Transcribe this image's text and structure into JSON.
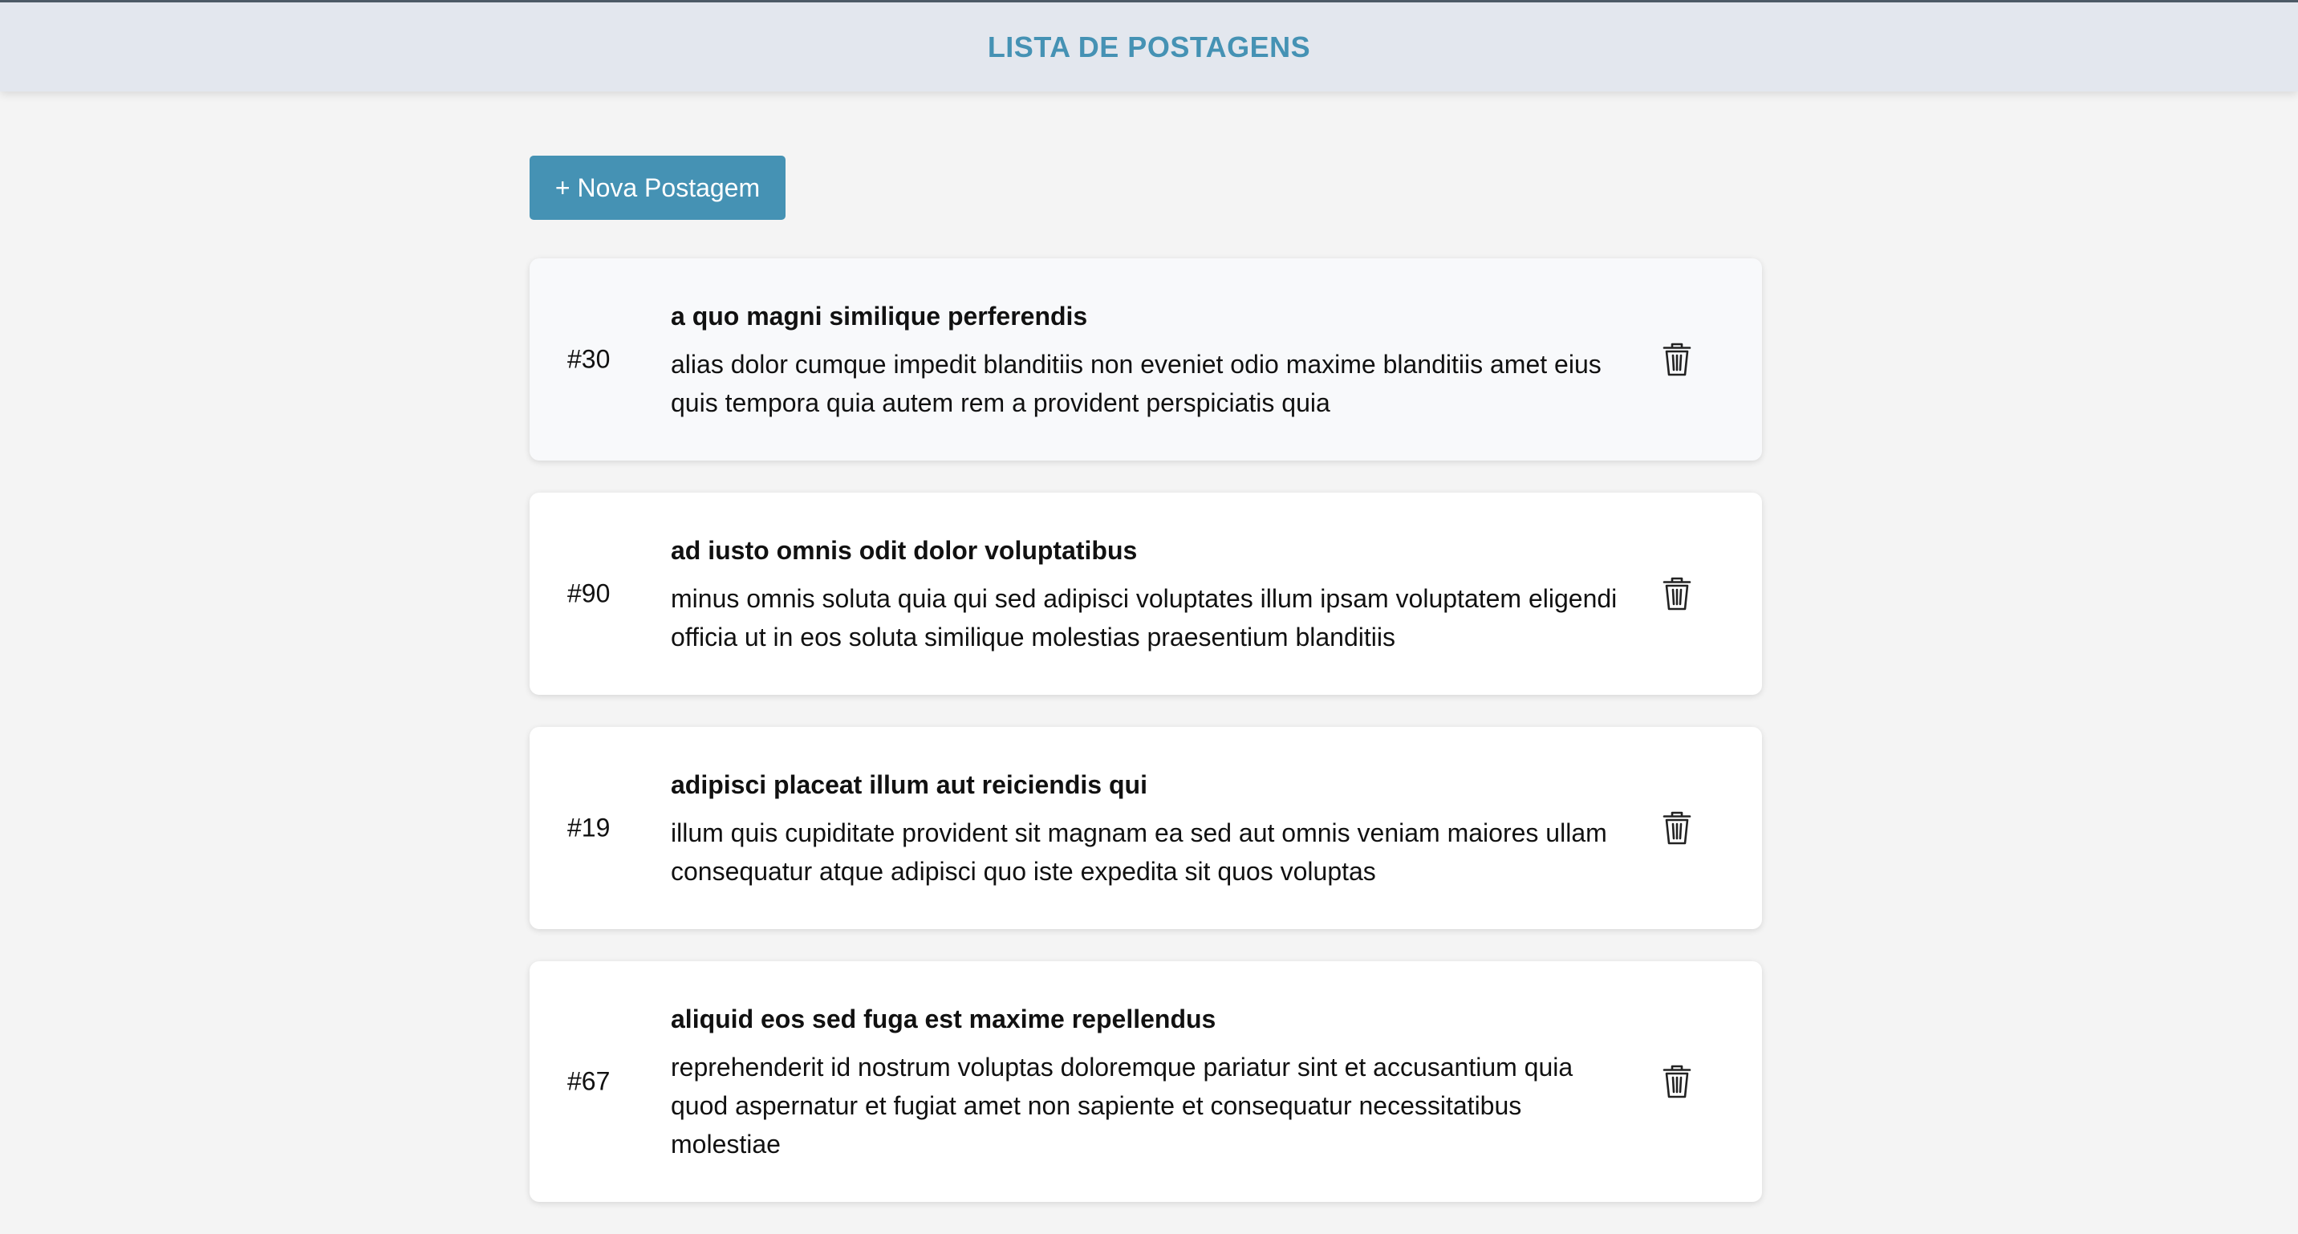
{
  "header": {
    "title": "LISTA DE POSTAGENS"
  },
  "toolbar": {
    "new_post_label": "+ Nova Postagem"
  },
  "colors": {
    "accent": "#4592b4",
    "header_bg": "#e3e7ee",
    "page_bg": "#f4f4f4"
  },
  "posts": [
    {
      "id_label": "#30",
      "title": "a quo magni similique perferendis",
      "body": "alias dolor cumque impedit blanditiis non eveniet odio maxime blanditiis amet eius quis tempora quia autem rem a provident perspiciatis quia",
      "action_icon": "trash-icon"
    },
    {
      "id_label": "#90",
      "title": "ad iusto omnis odit dolor voluptatibus",
      "body": "minus omnis soluta quia qui sed adipisci voluptates illum ipsam voluptatem eligendi officia ut in eos soluta similique molestias praesentium blanditiis",
      "action_icon": "trash-icon"
    },
    {
      "id_label": "#19",
      "title": "adipisci placeat illum aut reiciendis qui",
      "body": "illum quis cupiditate provident sit magnam ea sed aut omnis veniam maiores ullam consequatur atque adipisci quo iste expedita sit quos voluptas",
      "action_icon": "trash-icon"
    },
    {
      "id_label": "#67",
      "title": "aliquid eos sed fuga est maxime repellendus",
      "body": "reprehenderit id nostrum voluptas doloremque pariatur sint et accusantium quia quod aspernatur et fugiat amet non sapiente et consequatur necessitatibus molestiae",
      "action_icon": "trash-icon"
    }
  ]
}
